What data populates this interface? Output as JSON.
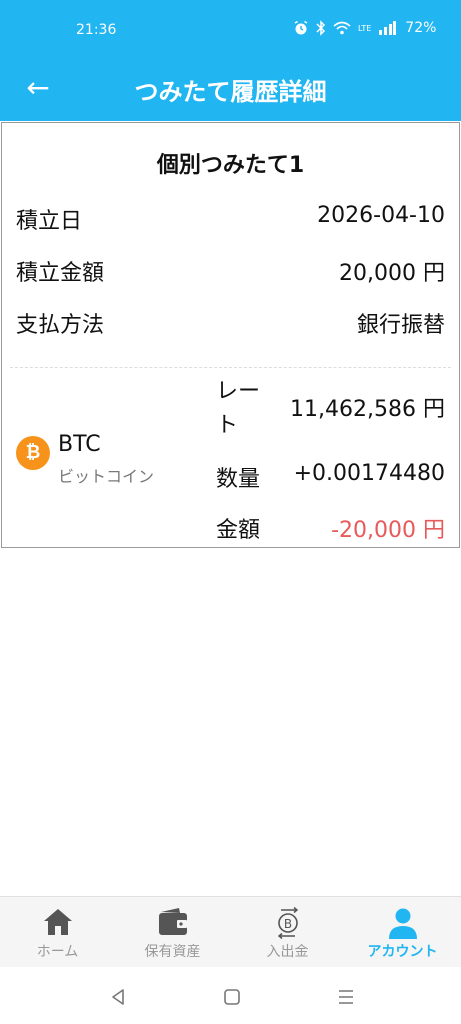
{
  "status": {
    "time": "21:36",
    "lte_label": "LTE",
    "battery": "72%"
  },
  "app_bar": {
    "back_icon": "←",
    "title": "つみたて履歴詳細"
  },
  "card": {
    "title": "個別つみたて1",
    "rows": [
      {
        "label": "積立日",
        "value": "2026-04-10"
      },
      {
        "label": "積立金額",
        "value": "20,000 円"
      },
      {
        "label": "支払方法",
        "value": "銀行振替"
      }
    ],
    "coin": {
      "icon_glyph": "₿",
      "symbol": "BTC",
      "name": "ビットコイン"
    },
    "details": {
      "rate_label_1": "レー",
      "rate_label_2": "ト",
      "rate_value": "11,462,586 円",
      "qty_label": "数量",
      "qty_value": "+0.00174480",
      "amount_label": "金額",
      "amount_value": "-20,000 円"
    }
  },
  "bottom_nav": {
    "items": [
      {
        "label": "ホーム",
        "icon": "home-icon"
      },
      {
        "label": "保有資産",
        "icon": "wallet-icon"
      },
      {
        "label": "入出金",
        "icon": "bitcoin-transfer-icon"
      },
      {
        "label": "アカウント",
        "icon": "person-icon",
        "active": true
      }
    ]
  },
  "colors": {
    "primary": "#21b5f2",
    "negative": "#e85a5a",
    "bitcoin": "#f7931a"
  }
}
